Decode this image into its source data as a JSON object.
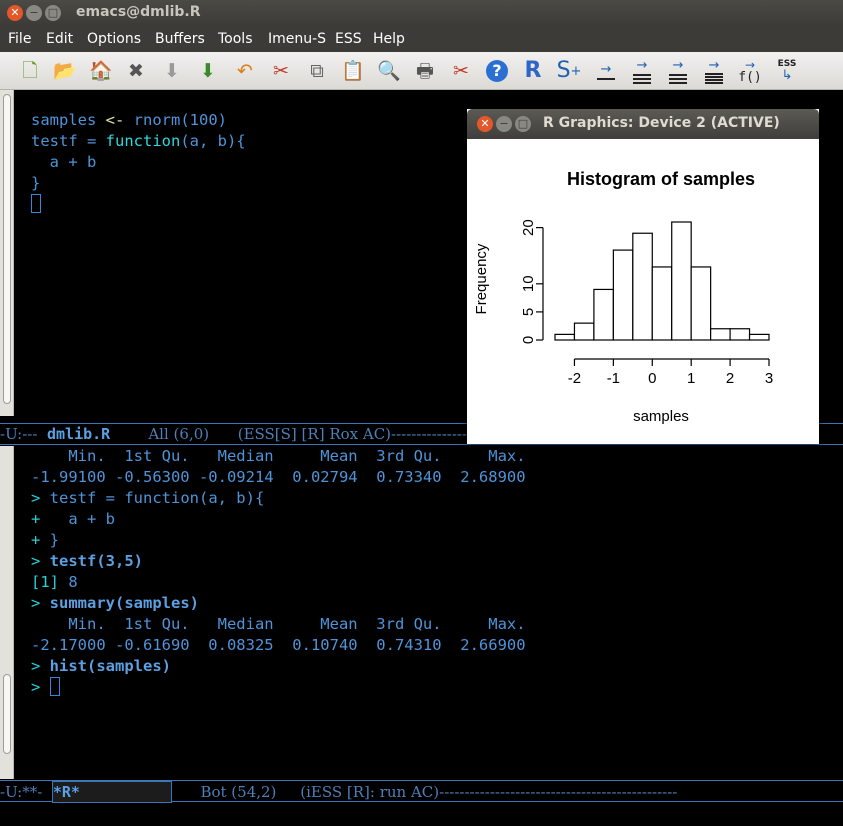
{
  "window": {
    "title": "emacs@dmlib.R"
  },
  "menu": [
    "File",
    "Edit",
    "Options",
    "Buffers",
    "Tools",
    "Imenu-S",
    "ESS",
    "Help"
  ],
  "toolbar": {
    "icons": [
      "new-file-icon",
      "open-file-icon",
      "open-directory-icon",
      "close-buffer-icon",
      "save-icon",
      "save-as-icon",
      "undo-icon",
      "cut-icon",
      "copy-icon",
      "paste-icon",
      "search-icon",
      "print-icon",
      "customize-icon",
      "help-icon",
      "r-icon",
      "s-plus-icon",
      "eval-line-icon",
      "eval-region-icon",
      "eval-function-icon",
      "eval-buffer-icon",
      "function-icon",
      "ess-icon"
    ],
    "r_label": "R",
    "s_label": "S",
    "s_sup": "+",
    "f_label": "f()",
    "ess_label": "ESS"
  },
  "editor": {
    "lines": {
      "l1a": "samples",
      "l1b": "<-",
      "l1c": " rnorm(100)",
      "l2a": "testf = ",
      "l2b": "function",
      "l2c": "(a, b){",
      "l3": "  a + b",
      "l4": "}"
    }
  },
  "modeline_top": {
    "left": "-U:---  ",
    "buffer": "dmlib.R",
    "right": "        All (6,0)      (ESS[S] [R] Rox AC)---------------------------------------------"
  },
  "console": {
    "summary1_header": "    Min.  1st Qu.   Median     Mean  3rd Qu.     Max.",
    "summary1_values": "-1.99100 -0.56300 -0.09214  0.02794  0.73340  2.68900",
    "p1": ">",
    "c1": " testf = function(a, b){",
    "p2": "+",
    "c2": "   a + b",
    "p3": "+",
    "c3": " }",
    "p4": ">",
    "c4": " testf(3,5)",
    "out_index": "[1]",
    "out_value": " 8",
    "p5": ">",
    "c5": " summary(samples)",
    "summary2_header": "    Min.  1st Qu.   Median     Mean  3rd Qu.     Max.",
    "summary2_values": "-2.17000 -0.61690  0.08325  0.10740  0.74310  2.66900",
    "p6": ">",
    "c6": " hist(samples)",
    "p7": ">"
  },
  "modeline_bottom": {
    "left": "-U:**-  ",
    "buffer": "*R*",
    "right": "      Bot (54,2)     (iESS [R]: run AC)-----------------------------------------------"
  },
  "rgraphics": {
    "title": "R Graphics: Device 2 (ACTIVE)"
  },
  "chart_data": {
    "type": "bar",
    "title": "Histogram of samples",
    "xlabel": "samples",
    "ylabel": "Frequency",
    "bins": [
      [
        -2.5,
        -2.0
      ],
      [
        -2.0,
        -1.5
      ],
      [
        -1.5,
        -1.0
      ],
      [
        -1.0,
        -0.5
      ],
      [
        -0.5,
        0.0
      ],
      [
        0.0,
        0.5
      ],
      [
        0.5,
        1.0
      ],
      [
        1.0,
        1.5
      ],
      [
        1.5,
        2.0
      ],
      [
        2.0,
        2.5
      ],
      [
        2.5,
        3.0
      ]
    ],
    "values": [
      1,
      3,
      9,
      16,
      19,
      13,
      21,
      13,
      2,
      2,
      1
    ],
    "xticks": [
      -2,
      -1,
      0,
      1,
      2,
      3
    ],
    "yticks": [
      0,
      5,
      10,
      20
    ],
    "xlim": [
      -2.5,
      3.0
    ],
    "ylim": [
      0,
      21
    ],
    "grid": false
  }
}
